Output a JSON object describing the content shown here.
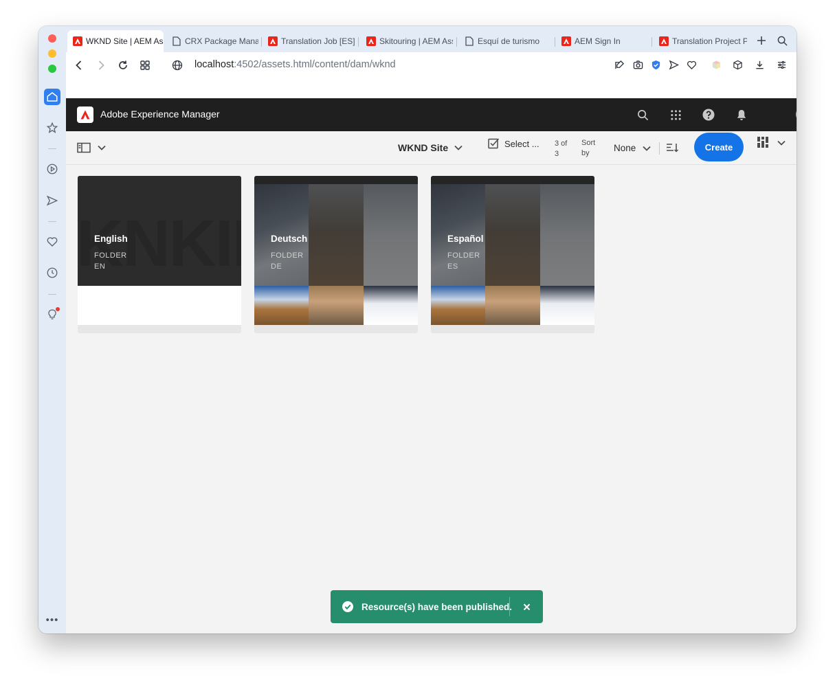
{
  "browser": {
    "tabs": [
      {
        "label": "WKND Site | AEM Ass",
        "icon": "adobe-icon",
        "active": true
      },
      {
        "label": "CRX Package Manag",
        "icon": "document-icon",
        "active": false
      },
      {
        "label": "Translation Job [ES]",
        "icon": "adobe-icon",
        "active": false
      },
      {
        "label": "Skitouring | AEM Ass",
        "icon": "adobe-icon",
        "active": false
      },
      {
        "label": "Esquí de turismo",
        "icon": "document-icon",
        "active": false
      },
      {
        "label": "AEM Sign In",
        "icon": "adobe-icon",
        "active": false
      },
      {
        "label": "Translation Project P",
        "icon": "adobe-icon",
        "active": false
      }
    ],
    "url_host": "localhost",
    "url_rest": ":4502/assets.html/content/dam/wknd"
  },
  "aem": {
    "title": "Adobe Experience Manager"
  },
  "actionbar": {
    "site": "WKND Site",
    "select_label": "Select ...",
    "count": "3 of 3",
    "sort_by": "Sort by",
    "sort_value": "None",
    "create_label": "Create"
  },
  "cards": [
    {
      "name": "English",
      "type": "FOLDER",
      "lang": "EN"
    },
    {
      "name": "Deutsch",
      "type": "FOLDER",
      "lang": "DE"
    },
    {
      "name": "Español",
      "type": "FOLDER",
      "lang": "ES"
    }
  ],
  "toast": {
    "message": "Resource(s) have been published.",
    "close_symbol": "×"
  },
  "colors": {
    "accent": "#1473e6",
    "toast": "#268e6c",
    "header": "#1f1f1f",
    "adobe_red": "#e8261c"
  }
}
